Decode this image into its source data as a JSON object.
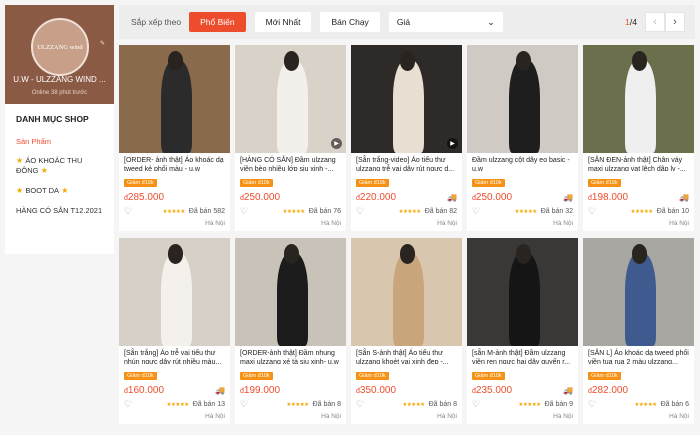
{
  "shop": {
    "logo_text": "ULZZANG wind",
    "name": "U.W - ULZZANG WIND ...",
    "online": "Online 38 phút trước",
    "categories_title": "DANH MỤC SHOP",
    "categories": [
      {
        "label": "Sản Phẩm",
        "active": true,
        "stars": false
      },
      {
        "label": "ÁO KHOÁC THU ĐÔNG",
        "active": false,
        "stars": true
      },
      {
        "label": "BOOT DA",
        "active": false,
        "stars": true
      },
      {
        "label": "HÀNG CÓ SẴN T12.2021",
        "active": false,
        "stars": false
      }
    ]
  },
  "sortbar": {
    "label": "Sắp xếp theo",
    "options": [
      "Phổ Biến",
      "Mới Nhất",
      "Bán Chạy"
    ],
    "active": "Phổ Biến",
    "price_label": "Giá",
    "page_current": "1",
    "page_total": "/4"
  },
  "products": [
    {
      "title": "[ORDER- ảnh thật] Áo khoác dạ tweed kẻ phối màu - u.w",
      "badge": "Giảm đ10k",
      "price": "285.000",
      "sold": "Đã bán 582",
      "location": "Hà Nội",
      "video": false,
      "freeship": false,
      "bg": "#8a6a4c",
      "cloth": "#2b2b2b"
    },
    {
      "title": "[HÀNG CÓ SẴN] Đầm ulzzang viền bèo nhiều lớp siu xinh -...",
      "badge": "Giảm đ10k",
      "price": "250.000",
      "sold": "Đã bán 76",
      "location": "Hà Nội",
      "video": true,
      "freeship": false,
      "bg": "#d9d2c8",
      "cloth": "#f3f0ec"
    },
    {
      "title": "[Sẵn trắng-video] Áo tiểu thư ulzzang trễ vai dây rút ngực d...",
      "badge": "Giảm đ10k",
      "price": "220.000",
      "sold": "Đã bán 82",
      "location": "Hà Nội",
      "video": true,
      "freeship": true,
      "bg": "#2e2a28",
      "cloth": "#e9dfd2"
    },
    {
      "title": "Đầm ulzzang cột dây eo basic - u.w",
      "badge": "Giảm đ10k",
      "price": "250.000",
      "sold": "Đã bán 32",
      "location": "Hà Nội",
      "video": false,
      "freeship": true,
      "bg": "#cfcac3",
      "cloth": "#1e1e1e"
    },
    {
      "title": "[SẴN ĐEN-ảnh thật] Chân váy maxi ulzzang vạt lệch dập ly -...",
      "badge": "Giảm đ10k",
      "price": "198.000",
      "sold": "Đã bán 10",
      "location": "Hà Nội",
      "video": false,
      "freeship": true,
      "bg": "#6c6f4c",
      "cloth": "#efefef"
    },
    {
      "title": "[Sẵn trắng] Áo trễ vai tiểu thư nhún ngực dây rút nhiều màu...",
      "badge": "Giảm đ10k",
      "price": "160.000",
      "sold": "Đã bán 13",
      "location": "Hà Nội",
      "video": false,
      "freeship": true,
      "bg": "#d7d0c7",
      "cloth": "#f4f1ec"
    },
    {
      "title": "[ORDER-ảnh thật] Đầm nhung maxi ulzzang xẻ tà siu xinh- u.w",
      "badge": "Giảm đ10k",
      "price": "199.000",
      "sold": "Đã bán 8",
      "location": "Hà Nội",
      "video": false,
      "freeship": false,
      "bg": "#c9c2b8",
      "cloth": "#1b1b1b"
    },
    {
      "title": "[Sẵn S-ảnh thật] Áo tiểu thư ulzzang khoét vai xinh đẹp -...",
      "badge": "Giảm đ10k",
      "price": "350.000",
      "sold": "Đã bán 8",
      "location": "Hà Nội",
      "video": false,
      "freeship": false,
      "bg": "#d9c6ae",
      "cloth": "#c9a57c"
    },
    {
      "title": "[sẵn M-ảnh thật] Đầm ulzzang viền ren ngực hai dây quyến r...",
      "badge": "Giảm đ10k",
      "price": "235.000",
      "sold": "Đã bán 9",
      "location": "Hà Nội",
      "video": false,
      "freeship": true,
      "bg": "#3a3836",
      "cloth": "#151515"
    },
    {
      "title": "[SẴN L] Áo khoác dạ tweed phối viền tua rua 2 màu ulzzang...",
      "badge": "Giảm đ10k",
      "price": "282.000",
      "sold": "Đã bán 6",
      "location": "Hà Nội",
      "video": false,
      "freeship": false,
      "bg": "#a7a6a0",
      "cloth": "#3e5a8e"
    }
  ],
  "currency_symbol": "đ",
  "colors": {
    "accent": "#ee4d2d",
    "badge": "#f69113",
    "freeship": "#00bfa5",
    "star": "#f6a700"
  }
}
